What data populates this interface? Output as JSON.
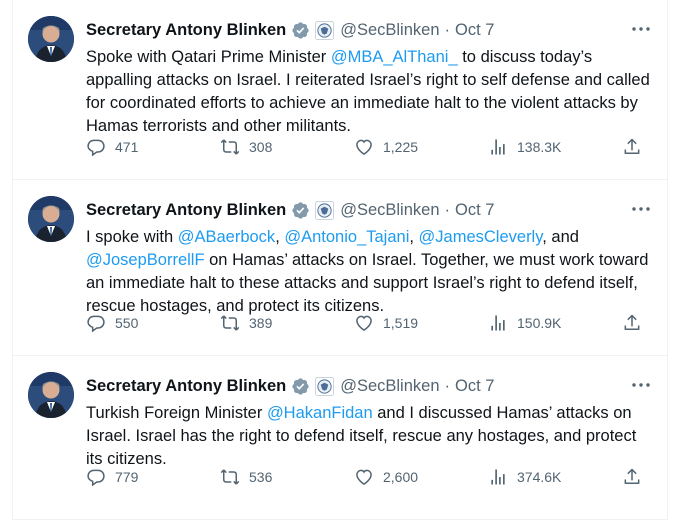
{
  "tweets": [
    {
      "author": "Secretary Antony Blinken",
      "handle": "@SecBlinken",
      "dot": "·",
      "date": "Oct 7",
      "body": [
        {
          "t": "Spoke with Qatari Prime Minister "
        },
        {
          "t": "@MBA_AlThani_",
          "m": true
        },
        {
          "t": " to discuss today’s appalling attacks on Israel. I reiterated Israel’s right to self defense and called for coordinated efforts to achieve an immediate halt to the violent attacks by Hamas terrorists and other militants."
        }
      ],
      "replies": "471",
      "reposts": "308",
      "likes": "1,225",
      "views": "138.3K"
    },
    {
      "author": "Secretary Antony Blinken",
      "handle": "@SecBlinken",
      "dot": "·",
      "date": "Oct 7",
      "body": [
        {
          "t": "I spoke with "
        },
        {
          "t": "@ABaerbock",
          "m": true
        },
        {
          "t": ", "
        },
        {
          "t": "@Antonio_Tajani",
          "m": true
        },
        {
          "t": ", "
        },
        {
          "t": "@JamesCleverly",
          "m": true
        },
        {
          "t": ", and "
        },
        {
          "t": "@JosepBorrellF",
          "m": true
        },
        {
          "t": " on Hamas’ attacks on Israel. Together, we must work toward an immediate halt to these attacks and support Israel’s right to defend itself, rescue hostages, and protect its citizens."
        }
      ],
      "replies": "550",
      "reposts": "389",
      "likes": "1,519",
      "views": "150.9K"
    },
    {
      "author": "Secretary Antony Blinken",
      "handle": "@SecBlinken",
      "dot": "·",
      "date": "Oct 7",
      "body": [
        {
          "t": "Turkish Foreign Minister "
        },
        {
          "t": "@HakanFidan",
          "m": true
        },
        {
          "t": " and I discussed Hamas’ attacks on Israel. Israel has the right to defend itself, rescue any hostages, and protect its citizens."
        }
      ],
      "replies": "779",
      "reposts": "536",
      "likes": "2,600",
      "views": "374.6K"
    }
  ],
  "colors": {
    "accent": "#1d9bf0",
    "text": "#0f1419",
    "muted": "#536471",
    "border": "#eff3f4",
    "verified": "#829aab"
  },
  "icons": [
    "avatar-photo",
    "verified-badge-icon",
    "state-department-seal-icon",
    "more-icon",
    "reply-icon",
    "repost-icon",
    "like-icon",
    "views-icon",
    "share-icon"
  ]
}
